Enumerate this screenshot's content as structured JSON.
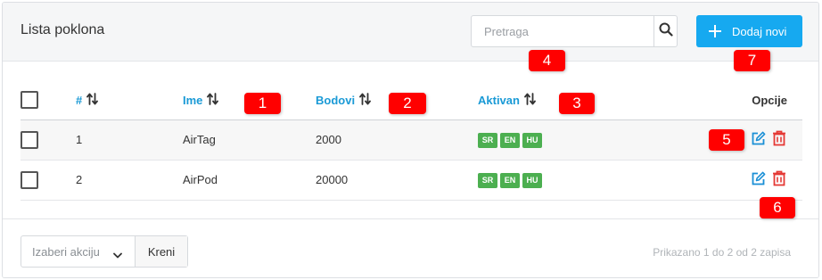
{
  "header": {
    "title": "Lista poklona",
    "search_placeholder": "Pretraga",
    "search_value": "",
    "search_icon": "search-icon",
    "add_label": "Dodaj novi",
    "add_icon": "plus-icon"
  },
  "table": {
    "columns": {
      "number": "#",
      "name": "Ime",
      "points": "Bodovi",
      "active": "Aktivan",
      "options": "Opcije"
    },
    "rows": [
      {
        "index": "1",
        "name": "AirTag",
        "points": "2000",
        "langs": [
          "SR",
          "EN",
          "HU"
        ]
      },
      {
        "index": "2",
        "name": "AirPod",
        "points": "20000",
        "langs": [
          "SR",
          "EN",
          "HU"
        ]
      }
    ]
  },
  "footer": {
    "bulk_action_placeholder": "Izaberi akciju",
    "apply_label": "Kreni",
    "info": "Prikazano 1 do 2 od 2 zapisa"
  },
  "markers": [
    "1",
    "2",
    "3",
    "4",
    "5",
    "6",
    "7"
  ],
  "colors": {
    "accent": "#16a9f0",
    "link": "#1a9ad6",
    "badge_green": "#4caf50",
    "delete_red": "#e53935",
    "edit_blue": "#1a8fd6",
    "marker_red": "#ff0000"
  }
}
